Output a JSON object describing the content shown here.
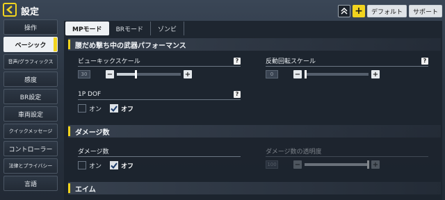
{
  "header": {
    "title": "設定",
    "default_label": "デフォルト",
    "support_label": "サポート"
  },
  "sidebar": {
    "items": [
      {
        "label": "操作"
      },
      {
        "label": "ベーシック"
      },
      {
        "label": "音声/グラフィックス"
      },
      {
        "label": "感度"
      },
      {
        "label": "BR設定"
      },
      {
        "label": "車両設定"
      },
      {
        "label": "クイックメッセージ"
      },
      {
        "label": "コントローラー"
      },
      {
        "label": "法律とプライバシー"
      },
      {
        "label": "言語"
      }
    ]
  },
  "tabs": [
    {
      "label": "MPモード"
    },
    {
      "label": "BRモード"
    },
    {
      "label": "ゾンビ"
    }
  ],
  "sections": {
    "hip_fire": {
      "title": "腰だめ撃ち中の武器パフォーマンス",
      "view_kick": {
        "label": "ビューキックスケール",
        "value": "30",
        "level": 0.3
      },
      "recoil": {
        "label": "反動回転スケール",
        "value": "0",
        "level": 0.0
      },
      "one_p_dof": {
        "label": "1P DOF",
        "on_label": "オン",
        "off_label": "オフ"
      }
    },
    "damage": {
      "title": "ダメージ数",
      "damage_number": {
        "label": "ダメージ数",
        "on_label": "オン",
        "off_label": "オフ"
      },
      "opacity": {
        "label": "ダメージ数の透明度",
        "value": "100",
        "level": 1.0
      }
    },
    "aim": {
      "title": "エイム"
    }
  },
  "colors": {
    "accent": "#f2d41e",
    "panel": "#1c242e"
  }
}
